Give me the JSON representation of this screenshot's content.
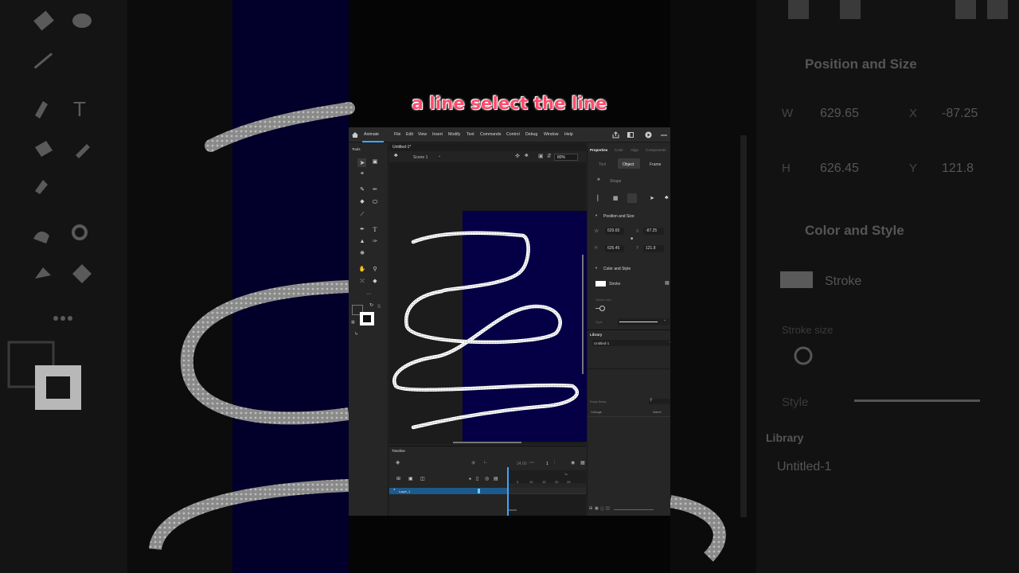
{
  "caption": "a line select the line",
  "menubar": {
    "app_label": "Animate",
    "items": [
      "File",
      "Edit",
      "View",
      "Insert",
      "Modify",
      "Text",
      "Commands",
      "Control",
      "Debug",
      "Window",
      "Help"
    ]
  },
  "tools_panel": {
    "title": "Tools"
  },
  "document": {
    "tab": "Untitled-1*",
    "scene": "Scene 1",
    "zoom": "80%"
  },
  "timeline": {
    "title": "Timeline",
    "fps": "24.00",
    "fps_unit": "FPS",
    "current_frame": "1",
    "frame_marks": [
      "5",
      "10",
      "15",
      "20",
      "25"
    ],
    "ruler_mark": "1s",
    "layer_name": "Layer_1"
  },
  "properties": {
    "tabs": [
      "Properties",
      "Color",
      "Align",
      "Components"
    ],
    "subtabs": [
      "Tool",
      "Object",
      "Frame"
    ],
    "object_kind": "Shape",
    "position_size": {
      "header": "Position and Size",
      "w_label": "W",
      "w": "629.65",
      "x_label": "X",
      "x": "-87.25",
      "h_label": "H",
      "h": "626.45",
      "y_label": "Y",
      "y": "121.8"
    },
    "color_style": {
      "header": "Color and Style",
      "stroke_label": "Stroke",
      "stroke_color": "#ffffff",
      "stroke_size_label": "Stroke size",
      "style_label": "Style"
    }
  },
  "library": {
    "title": "Library",
    "document": "Untitled-1",
    "empty_text": "Empty library",
    "col_linkage": "Linkage",
    "col_name": "Name"
  },
  "colors": {
    "stage_bg": "#050045",
    "accent": "#3ea6ff",
    "layer_highlight": "#1d5a8c",
    "caption": "#ff4a6a"
  }
}
